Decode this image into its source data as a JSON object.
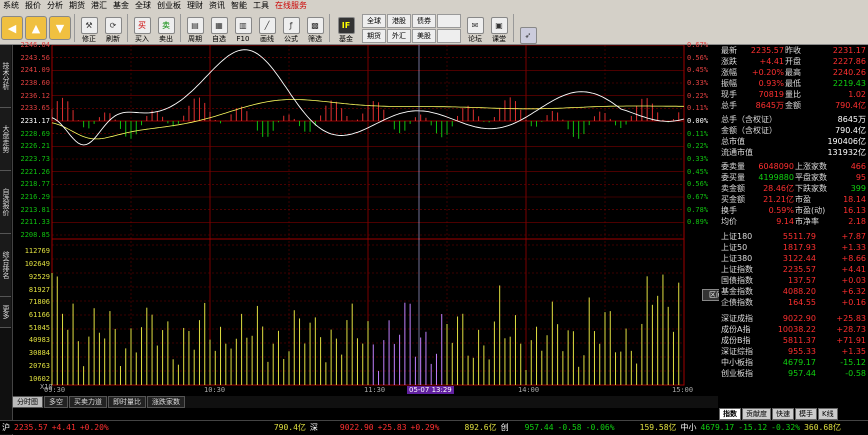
{
  "menu": {
    "items": [
      "系统",
      "报价",
      "分析",
      "期货",
      "港汇",
      "基金",
      "全球",
      "创业板",
      "理财",
      "资讯",
      "智能",
      "工具",
      "在线服务"
    ]
  },
  "toolbar": {
    "buttons": [
      {
        "label": "修正",
        "icon": "wrench-icon"
      },
      {
        "label": "刷新",
        "icon": "refresh-icon"
      },
      {
        "label": "买入",
        "icon": "buy-icon",
        "glyph": "买"
      },
      {
        "label": "卖出",
        "icon": "sell-icon",
        "glyph": "卖"
      },
      {
        "label": "周期",
        "icon": "period-icon"
      },
      {
        "label": "自选",
        "icon": "favorites-icon"
      },
      {
        "label": "F10",
        "icon": "f10-icon"
      },
      {
        "label": "画线",
        "icon": "draw-line-icon"
      },
      {
        "label": "公式",
        "icon": "formula-icon"
      },
      {
        "label": "筛选",
        "icon": "filter-icon"
      },
      {
        "label": "基金",
        "icon": "fund-icon",
        "glyph": "IF"
      },
      {
        "label": "论坛",
        "icon": "forum-icon"
      },
      {
        "label": "课堂",
        "icon": "classroom-icon"
      }
    ],
    "small": [
      "全球",
      "港股",
      "债券",
      "期货",
      "外汇",
      "美股"
    ]
  },
  "left_tabs": [
    "技术分析",
    "大盘走势",
    "自选报价",
    "综合排名",
    "更多"
  ],
  "chart": {
    "price_labels_left": [
      "2246.04",
      "2243.56",
      "2241.09",
      "2238.60",
      "2236.12",
      "2233.65",
      "2231.17",
      "2228.69",
      "2226.21",
      "2223.73",
      "2221.26",
      "2218.77",
      "2216.29",
      "2213.81",
      "2211.33",
      "2208.85"
    ],
    "pct_labels_right": [
      "0.67%",
      "0.56%",
      "0.45%",
      "0.33%",
      "0.22%",
      "0.11%",
      "0.00%",
      "0.11%",
      "0.22%",
      "0.33%",
      "0.45%",
      "0.56%",
      "0.67%",
      "0.78%",
      "0.89%"
    ],
    "volume_labels": [
      "112769",
      "102649",
      "92529",
      "81927",
      "71806",
      "61166",
      "51045",
      "40983",
      "30884",
      "20763",
      "10602"
    ],
    "x_ticks": [
      "09:30",
      "10:30",
      "11:30",
      "14:00",
      "15:00"
    ],
    "cursor_time": "05-07 13:29",
    "range_button": "区间",
    "scale_label": "X10"
  },
  "chart_data": {
    "type": "line",
    "x": [
      "09:30",
      "10:30",
      "11:30",
      "14:00",
      "15:00"
    ],
    "ylim": [
      2208.85,
      2246.04
    ],
    "series": []
  },
  "bottom_tabs": [
    "分时图",
    "多空",
    "买卖力道",
    "即时量比",
    "涨跌家数"
  ],
  "quote": {
    "rows": [
      {
        "l": "最新",
        "v": "2235.57",
        "l2": "昨收",
        "v2": "2231.17"
      },
      {
        "l": "涨跌",
        "v": "+4.41",
        "l2": "开盘",
        "v2": "2227.86"
      },
      {
        "l": "涨幅",
        "v": "+0.20%",
        "l2": "最高",
        "v2": "2240.26"
      },
      {
        "l": "振幅",
        "v": "0.93%",
        "l2": "最低",
        "v2": "2219.43"
      },
      {
        "l": "现手",
        "v": "70819",
        "l2": "量比",
        "v2": "1.02"
      },
      {
        "l": "总手",
        "v": "8645万",
        "l2": "金额",
        "v2": "790.4亿"
      }
    ],
    "rows2": [
      {
        "l": "总手（含权证）",
        "v": "8645万"
      },
      {
        "l": "金额（含权证）",
        "v": "790.4亿"
      },
      {
        "l": "总市值",
        "v": "190406亿"
      },
      {
        "l": "流通市值",
        "v": "131932亿"
      }
    ],
    "rows3": [
      {
        "l": "委卖量",
        "v": "6048090",
        "l2": "上涨家数",
        "v2": "466"
      },
      {
        "l": "委买量",
        "v": "4199880",
        "l2": "平盘家数",
        "v2": "95"
      },
      {
        "l": "卖金额",
        "v": "28.46亿",
        "l2": "下跌家数",
        "v2": "399"
      },
      {
        "l": "买金额",
        "v": "21.21亿",
        "l2": "市盈",
        "v2": "18.14"
      },
      {
        "l": "换手",
        "v": "0.59%",
        "l2": "市盈(动)",
        "v2": "16.13"
      },
      {
        "l": "均价",
        "v": "9.14",
        "l2": "市净率",
        "v2": "2.18"
      }
    ],
    "indices": [
      {
        "n": "上证180",
        "v": "5511.79",
        "c": "+7.87"
      },
      {
        "n": "上证50",
        "v": "1817.93",
        "c": "+1.33"
      },
      {
        "n": "上证380",
        "v": "3122.44",
        "c": "+8.66"
      },
      {
        "n": "上证指数",
        "v": "2235.57",
        "c": "+4.41"
      },
      {
        "n": "国债指数",
        "v": "137.57",
        "c": "+0.03"
      },
      {
        "n": "基金指数",
        "v": "4088.20",
        "c": "+6.32"
      },
      {
        "n": "企债指数",
        "v": "164.55",
        "c": "+0.16"
      },
      {
        "n": "深证成指",
        "v": "9022.90",
        "c": "+25.83"
      },
      {
        "n": "成份A指",
        "v": "10038.22",
        "c": "+28.73"
      },
      {
        "n": "成份B指",
        "v": "5811.37",
        "c": "+71.91"
      },
      {
        "n": "深证综指",
        "v": "955.33",
        "c": "+1.35"
      },
      {
        "n": "中小板指",
        "v": "4679.17",
        "c": "-15.12"
      },
      {
        "n": "创业板指",
        "v": "957.44",
        "c": "-0.58"
      }
    ]
  },
  "right_tabs": [
    "指数",
    "贡献度",
    "快速",
    "模手",
    "K线"
  ],
  "ticker": {
    "sh_label": "沪",
    "sh_price": "2235.57",
    "sh_chg": "+4.41",
    "sh_pct": "+0.20%",
    "sh_amt": "790.4亿",
    "sz_label": "深",
    "sz_price": "9022.90",
    "sz_chg": "+25.83",
    "sz_pct": "+0.29%",
    "sz_amt": "892.6亿",
    "cy_label": "创",
    "cy_price": "957.44",
    "cy_chg": "-0.58",
    "cy_pct": "-0.06%",
    "cy_amt": "159.58亿",
    "zx_label": "中小",
    "zx_price": "4679.17",
    "zx_chg": "-15.12",
    "zx_pct": "-0.32%",
    "zx_amt": "360.68亿"
  },
  "colors": {
    "up": "#ff3030",
    "down": "#00c000",
    "grid": "#800000",
    "price_line": "#ffffff",
    "avg_line": "#ffff00",
    "vol": "#e0e040"
  }
}
